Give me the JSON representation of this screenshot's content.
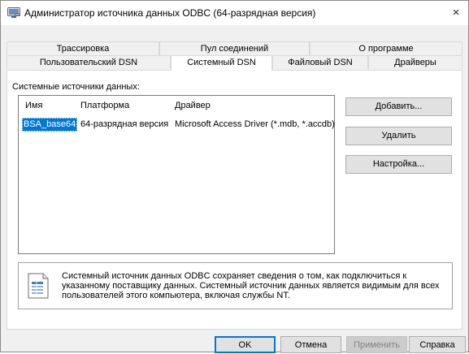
{
  "window": {
    "title": "Администратор источника данных ODBC (64-разрядная версия)",
    "close_glyph": "×"
  },
  "tabs_row1": [
    {
      "label": "Трассировка"
    },
    {
      "label": "Пул соединений"
    },
    {
      "label": "О программе"
    }
  ],
  "tabs_row2": [
    {
      "label": "Пользовательский DSN"
    },
    {
      "label": "Системный DSN",
      "active": true
    },
    {
      "label": "Файловый DSN"
    },
    {
      "label": "Драйверы"
    }
  ],
  "main": {
    "section_label": "Системные источники данных:",
    "columns": [
      "Имя",
      "Платформа",
      "Драйвер"
    ],
    "rows": [
      {
        "name": "BSA_base64",
        "platform": "64-разрядная версия",
        "driver": "Microsoft Access Driver (*.mdb, *.accdb)",
        "selected": true
      }
    ],
    "buttons": {
      "add": "Добавить...",
      "remove": "Удалить",
      "configure": "Настройка..."
    },
    "info_lines": [
      "Системный источник данных ODBC сохраняет сведения о том, как подключиться к",
      "указанному поставщику данных.  Системный источник данных является видимым для всех",
      "пользователей этого компьютера, включая службы NT."
    ]
  },
  "footer": {
    "ok": "OK",
    "cancel": "Отмена",
    "apply": "Применить",
    "help": "Справка"
  },
  "icons": {
    "title": "odbc-admin-icon",
    "info": "database-document-icon"
  },
  "colors": {
    "selection": "#0078d7",
    "window_bg": "#f0f0f0"
  }
}
